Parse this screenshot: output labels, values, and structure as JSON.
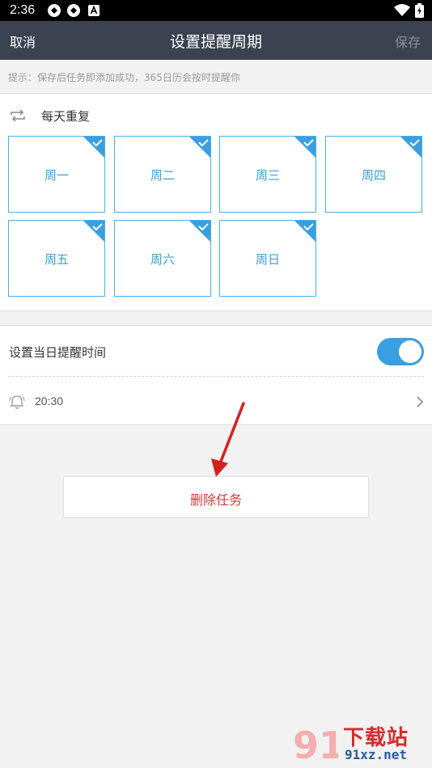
{
  "status_bar": {
    "time": "2:36",
    "icons": [
      "sync-icon",
      "sync-icon",
      "a-badge-icon",
      "wifi-icon",
      "battery-icon"
    ]
  },
  "nav": {
    "cancel_label": "取消",
    "title": "设置提醒周期",
    "save_label": "保存"
  },
  "hint": {
    "text": "提示：保存后任务即添加成功，365日历会按时提醒你"
  },
  "repeat": {
    "icon": "repeat-icon",
    "label": "每天重复",
    "days": [
      {
        "label": "周一",
        "checked": true
      },
      {
        "label": "周二",
        "checked": true
      },
      {
        "label": "周三",
        "checked": true
      },
      {
        "label": "周四",
        "checked": true
      },
      {
        "label": "周五",
        "checked": true
      },
      {
        "label": "周六",
        "checked": true
      },
      {
        "label": "周日",
        "checked": true
      }
    ]
  },
  "reminder": {
    "label": "设置当日提醒时间",
    "enabled": true,
    "time_icon": "bell-icon",
    "time": "20:30"
  },
  "delete_button": {
    "label": "删除任务"
  },
  "watermark": {
    "brand": "下载站",
    "url": "91xz.net",
    "logo_text": "91"
  },
  "colors": {
    "navbar": "#3b4351",
    "accent": "#3a9fe0",
    "delete": "#d23a3a",
    "annotation_arrow": "#d42020"
  }
}
